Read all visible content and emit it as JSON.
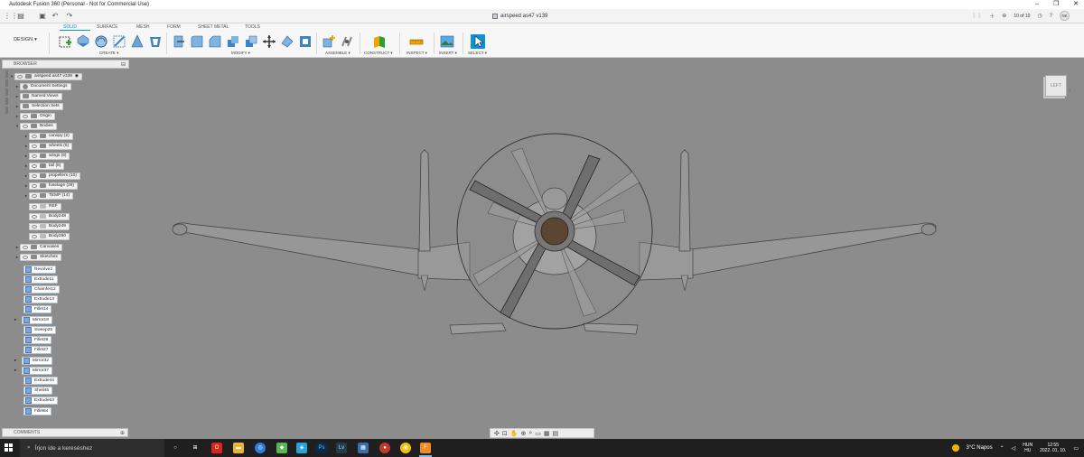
{
  "window": {
    "title": "Autodesk Fusion 360 (Personal - Not for Commercial Use)",
    "controls": [
      "–",
      "❐",
      "✕"
    ]
  },
  "document": {
    "tab_name": "airspeed as47 v139",
    "jobs": "10 of 10",
    "user_initials": "NK"
  },
  "ribbon": {
    "workspace": "DESIGN",
    "tabs": [
      "SOLID",
      "SURFACE",
      "MESH",
      "FORM",
      "SHEET METAL",
      "TOOLS"
    ],
    "active_tab": "SOLID",
    "groups": [
      "CREATE",
      "MODIFY",
      "ASSEMBLE",
      "CONSTRUCT",
      "INSPECT",
      "INSERT",
      "SELECT"
    ]
  },
  "browser": {
    "title": "BROWSER",
    "root": "airspeed as47 v139",
    "items": [
      "Document Settings",
      "Named Views",
      "Selection Sets",
      "Origin",
      "Bodies",
      "canopy (2)",
      "wheels (5)",
      "wings (6)",
      "tail (8)",
      "propellers (10)",
      "fuselage (29)",
      "TEMP (14)",
      "REF",
      "Body248",
      "Body249",
      "Body250",
      "Canvases",
      "Sketches"
    ]
  },
  "timeline": {
    "features": [
      "Revolve2",
      "Extrude11",
      "Chamfer12",
      "Extrude13",
      "Fillet14",
      "Mirror18",
      "Sweep25",
      "Fillet26",
      "Fillet27",
      "Mirror32",
      "Mirror37",
      "Extrude44",
      "Shell45",
      "Extrude63",
      "Fillet64"
    ]
  },
  "comments": {
    "title": "COMMENTS"
  },
  "viewcube": {
    "face": "LEFT"
  },
  "taskbar": {
    "search_placeholder": "Írjon ide a kereséshez",
    "weather": "3°C  Napos",
    "lang_top": "HUN",
    "lang_bottom": "HU",
    "time": "12:55",
    "date": "2022. 01. 10."
  },
  "colors": {
    "accent": "#0696d7",
    "viewport": "#8c8c8c",
    "taskbar": "#1f1f1f"
  }
}
